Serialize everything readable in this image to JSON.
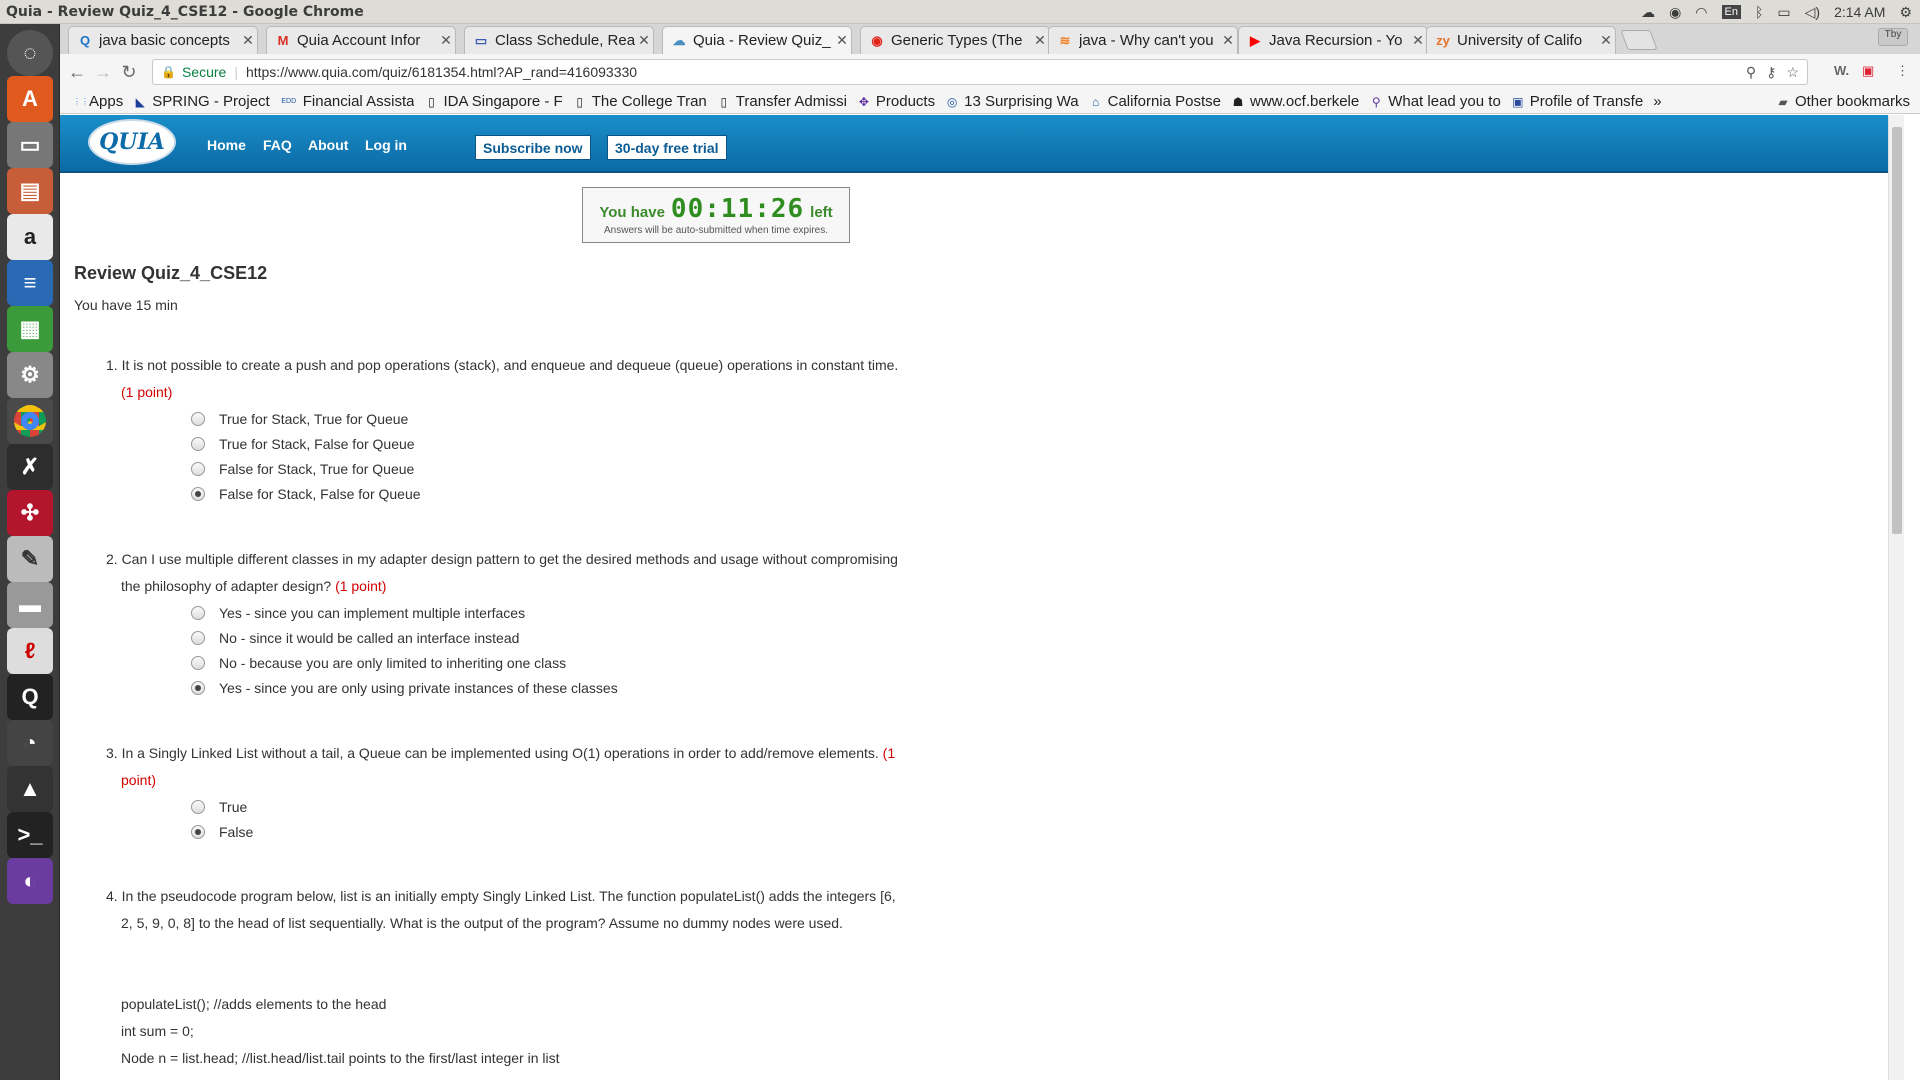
{
  "window": {
    "title": "Quia - Review Quiz_4_CSE12 - Google Chrome"
  },
  "tray": {
    "lang": "En",
    "time": "2:14 AM"
  },
  "tabs": [
    {
      "label": "java basic concepts",
      "icon": "Q",
      "color": "#1a73c9"
    },
    {
      "label": "Quia Account Infor",
      "icon": "M",
      "color": "#d93025"
    },
    {
      "label": "Class Schedule, Rea",
      "icon": "▭",
      "color": "#3b5bb0"
    },
    {
      "label": "Quia - Review Quiz_",
      "icon": "☁",
      "color": "#4a8fc0"
    },
    {
      "label": "Generic Types (The",
      "icon": "◉",
      "color": "#e2231a"
    },
    {
      "label": "java - Why can't you",
      "icon": "≋",
      "color": "#f48024"
    },
    {
      "label": "Java Recursion - Yo",
      "icon": "▶",
      "color": "#ff0000"
    },
    {
      "label": "University of Califo",
      "icon": "zy",
      "color": "#e8742a"
    }
  ],
  "toolbar": {
    "secure": "Secure",
    "url": "https://www.quia.com/quiz/6181354.html?AP_rand=416093330"
  },
  "bookmarks": [
    {
      "label": "Apps",
      "icon": "⋮⋮⋮"
    },
    {
      "label": "SPRING - Project",
      "icon": "◣"
    },
    {
      "label": "Financial Assista",
      "icon": "EDD"
    },
    {
      "label": "IDA Singapore - F",
      "icon": "▯"
    },
    {
      "label": "The College Tran",
      "icon": "▯"
    },
    {
      "label": "Transfer Admissi",
      "icon": "▯"
    },
    {
      "label": "Products",
      "icon": "✥"
    },
    {
      "label": "13 Surprising Wa",
      "icon": "◎"
    },
    {
      "label": "California Postse",
      "icon": "⌂"
    },
    {
      "label": "www.ocf.berkele",
      "icon": "☗"
    },
    {
      "label": "What lead you to",
      "icon": "⚲"
    },
    {
      "label": "Profile of Transfe",
      "icon": "▣"
    }
  ],
  "bookmarks_more": "»",
  "other_bookmarks": "Other bookmarks",
  "quia": {
    "logo": "QUIA",
    "nav": [
      "Home",
      "FAQ",
      "About",
      "Log in"
    ],
    "subscribe": "Subscribe now",
    "trial": "30-day free trial"
  },
  "timer": {
    "prefix": "You have",
    "value": "00:11:26",
    "suffix": "left",
    "note": "Answers will be auto-submitted when time expires."
  },
  "quiz": {
    "title": "Review Quiz_4_CSE12",
    "subtitle": "You have 15 min"
  },
  "questions": [
    {
      "text": "1. It is not possible to create a push and pop operations (stack), and enqueue and dequeue (queue) operations in constant time.",
      "points": "(1 point)",
      "options": [
        "True for Stack, True for Queue",
        "True for Stack, False for Queue",
        "False for Stack, True for Queue",
        "False for Stack, False for Queue"
      ],
      "selected": 3
    },
    {
      "text": "2. Can I use multiple different classes in my adapter design pattern to get the desired methods and usage without compromising the philosophy of adapter design?",
      "points": "(1 point)",
      "options": [
        "Yes - since you can implement multiple interfaces",
        "No - since it would be called an interface instead",
        "No - because you are only limited to inheriting one class",
        "Yes - since you are only using private instances of these classes"
      ],
      "selected": 3
    },
    {
      "text": "3. In a Singly Linked List without a tail, a Queue can be implemented using O(1) operations in order to add/remove elements.",
      "points": "(1 point)",
      "options": [
        "True",
        "False"
      ],
      "selected": 1
    },
    {
      "text": "4. In the pseudocode program below, list is an initially empty Singly Linked List. The function populateList() adds the integers [6, 2, 5, 9, 0, 8] to the head of list sequentially. What is the output of the program? Assume no dummy nodes were used.",
      "code": [
        "populateList(); //adds elements to the head",
        "int sum = 0;",
        "Node n = list.head; //list.head/list.tail points to the first/last integer in list"
      ]
    }
  ]
}
